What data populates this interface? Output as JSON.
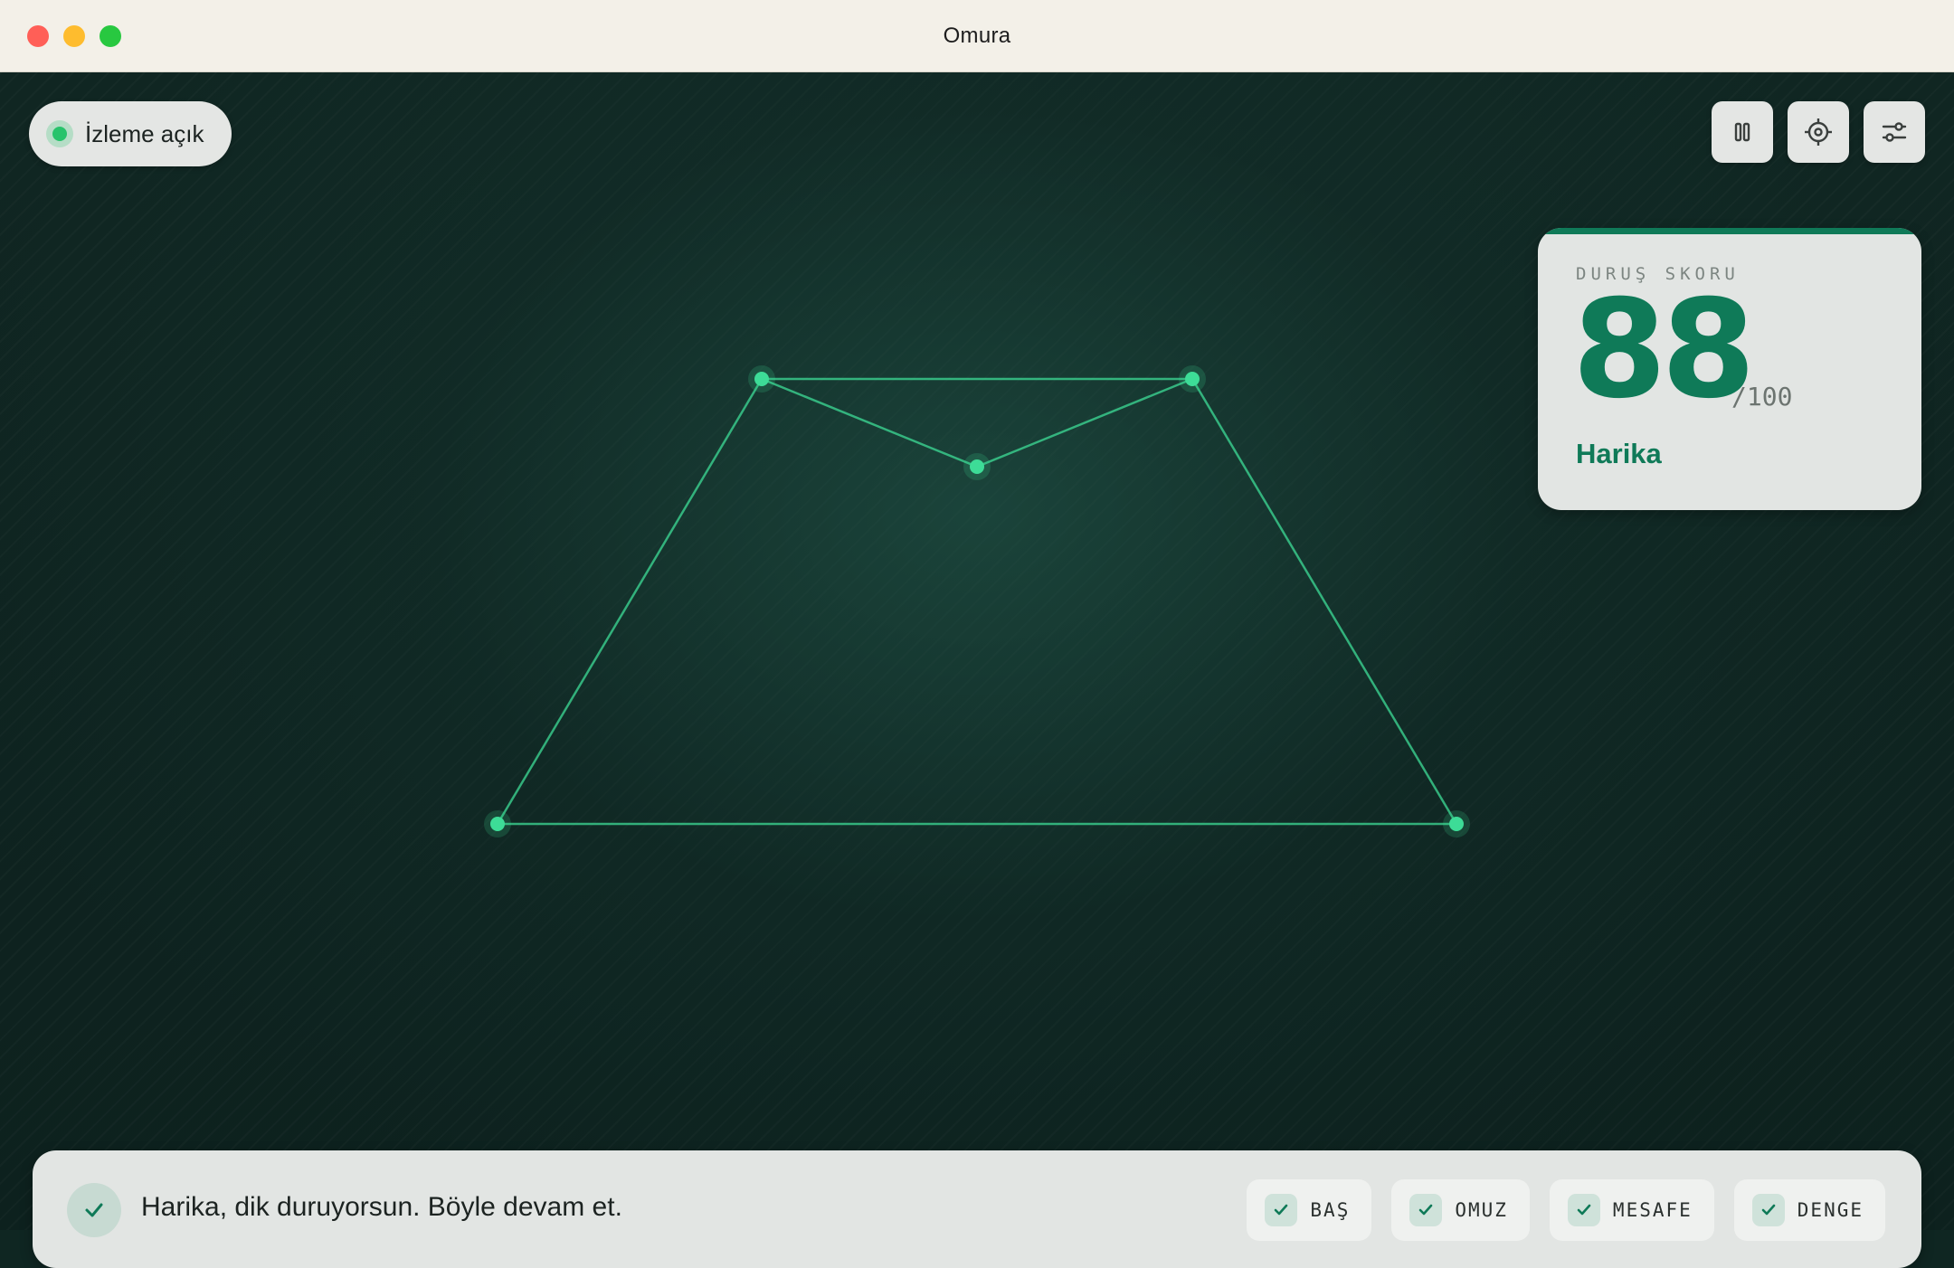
{
  "window": {
    "title": "Omura"
  },
  "status": {
    "label": "İzleme açık",
    "color": "#27c36b"
  },
  "toolbar": {
    "buttons": [
      {
        "icon": "pause-icon"
      },
      {
        "icon": "crosshair-icon"
      },
      {
        "icon": "sliders-icon"
      }
    ]
  },
  "score": {
    "heading": "DURUŞ SKORU",
    "value": "88",
    "max": "/100",
    "rating": "Harika",
    "accent_color": "#0f7a58"
  },
  "feedback": {
    "message": "Harika, dik duruyorsun. Böyle devam et.",
    "chips": [
      {
        "label": "BAŞ",
        "icon": "check-icon"
      },
      {
        "label": "OMUZ",
        "icon": "check-icon"
      },
      {
        "label": "MESAFE",
        "icon": "check-icon"
      },
      {
        "label": "DENGE",
        "icon": "check-icon"
      }
    ]
  },
  "colors": {
    "skeleton": "#3ddc97",
    "background": "#0f2622"
  }
}
